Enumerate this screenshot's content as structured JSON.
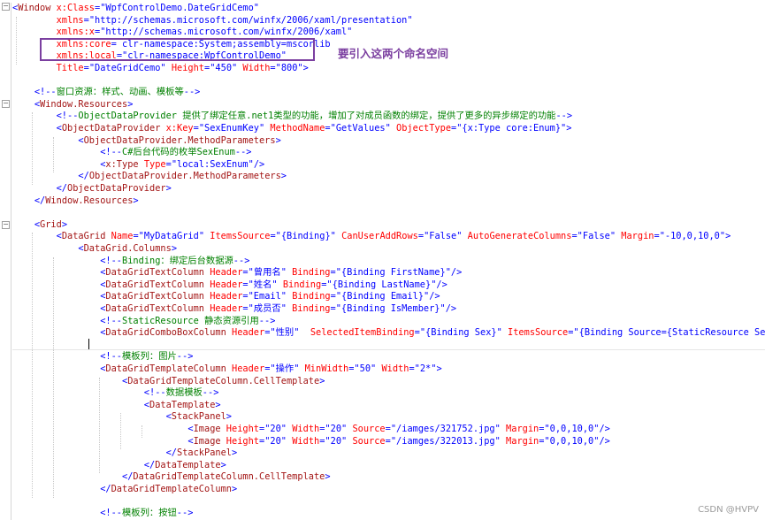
{
  "lines": [
    "<Window x:Class=\"WpfControlDemo.DateGridCemo\"",
    "        xmlns=\"http://schemas.microsoft.com/winfx/2006/xaml/presentation\"",
    "        xmlns:x=\"http://schemas.microsoft.com/winfx/2006/xaml\"",
    "        xmlns:core= clr-namespace:System;assembly=mscorlib",
    "        xmlns:local=\"clr-namespace:WpfControlDemo\"",
    "        Title=\"DateGridCemo\" Height=\"450\" Width=\"800\">",
    "",
    "    <!--窗口资源：样式、动画、模板等-->",
    "    <Window.Resources>",
    "        <!--ObjectDataProvider 提供了绑定任意.net1类型的功能，增加了对成员函数的绑定，提供了更多的异步绑定的功能-->",
    "        <ObjectDataProvider x:Key=\"SexEnumKey\" MethodName=\"GetValues\" ObjectType=\"{x:Type core:Enum}\">",
    "            <ObjectDataProvider.MethodParameters>",
    "                <!--C#后台代码的枚举SexEnum-->",
    "                <x:Type Type=\"local:SexEnum\"/>",
    "            </ObjectDataProvider.MethodParameters>",
    "        </ObjectDataProvider>",
    "    </Window.Resources>",
    "",
    "    <Grid>",
    "        <DataGrid Name=\"MyDataGrid\" ItemsSource=\"{Binding}\" CanUserAddRows=\"False\" AutoGenerateColumns=\"False\" Margin=\"-10,0,10,0\">",
    "            <DataGrid.Columns>",
    "                <!--Binding：绑定后台数据源-->",
    "                <DataGridTextColumn Header=\"曾用名\" Binding=\"{Binding FirstName}\"/>",
    "                <DataGridTextColumn Header=\"姓名\" Binding=\"{Binding LastName}\"/>",
    "                <DataGridTextColumn Header=\"Email\" Binding=\"{Binding Email}\"/>",
    "                <DataGridTextColumn Header=\"成员否\" Binding=\"{Binding IsMember}\"/>",
    "                <!--StaticResource 静态资源引用-->",
    "                <DataGridComboBoxColumn Header=\"性别\"  SelectedItemBinding=\"{Binding Sex}\" ItemsSource=\"{Binding Source={StaticResource SexEnumKey}}\" />",
    "",
    "                <!--模板列：图片-->",
    "                <DataGridTemplateColumn Header=\"操作\" MinWidth=\"50\" Width=\"2*\">",
    "                    <DataGridTemplateColumn.CellTemplate>",
    "                        <!--数据模板-->",
    "                        <DataTemplate>",
    "                            <StackPanel>",
    "                                <Image Height=\"20\" Width=\"20\" Source=\"/iamges/321752.jpg\" Margin=\"0,0,10,0\"/>",
    "                                <Image Height=\"20\" Width=\"20\" Source=\"/iamges/322013.jpg\" Margin=\"0,0,10,0\"/>",
    "                            </StackPanel>",
    "                        </DataTemplate>",
    "                    </DataGridTemplateColumn.CellTemplate>",
    "                </DataGridTemplateColumn>",
    "",
    "                <!--模板列：按钮-->"
  ],
  "annotation": "要引入这两个命名空间",
  "watermark": "CSDN @HVPV",
  "colors": {
    "element": "#a31515",
    "attribute": "#ff0000",
    "value": "#0000ff",
    "comment": "#008000",
    "highlight": "#7b3fa0"
  }
}
